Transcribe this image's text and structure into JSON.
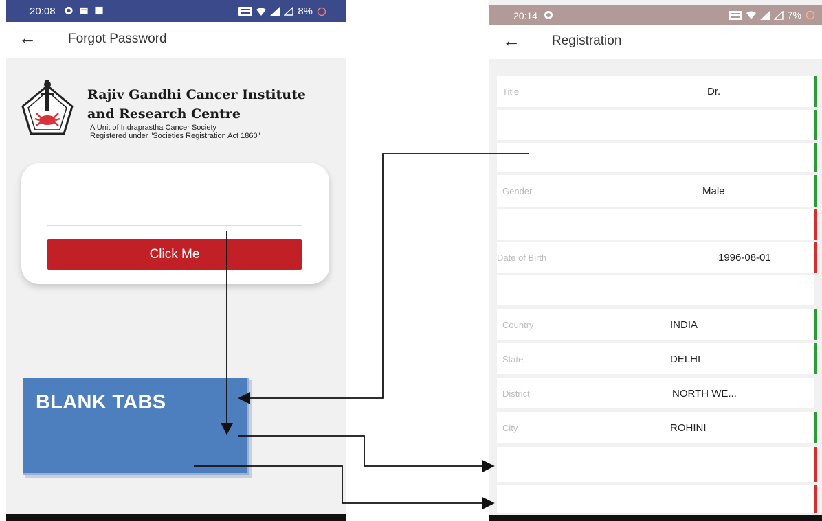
{
  "left_screen": {
    "status": {
      "time": "20:08",
      "battery": "8%"
    },
    "appbar": {
      "back_icon": "←",
      "title": "Forgot Password"
    },
    "institute": {
      "name_line1": "Rajiv Gandhi Cancer Institute",
      "name_line2": "and Research Centre",
      "sub_line1": "A Unit of Indraprastha Cancer Society",
      "sub_line2": "Registered under \"Societies Registration Act 1860\""
    },
    "button_label": "Click Me",
    "annotation_label": "BLANK TABS"
  },
  "right_screen": {
    "status": {
      "time": "20:14",
      "battery": "7%"
    },
    "appbar": {
      "back_icon": "←",
      "title": "Registration"
    },
    "rows": [
      {
        "label": "Title",
        "value": "Dr."
      },
      {
        "label": "",
        "value": ""
      },
      {
        "label": "",
        "value": ""
      },
      {
        "label": "Gender",
        "value": "Male"
      },
      {
        "label": "",
        "value": ""
      },
      {
        "label": "Date of Birth",
        "value": "1996-08-01"
      },
      {
        "label": "",
        "value": ""
      },
      {
        "label": "Country",
        "value": "INDIA"
      },
      {
        "label": "State",
        "value": "DELHI"
      },
      {
        "label": "District",
        "value": "NORTH WE..."
      },
      {
        "label": "City",
        "value": "ROHINI"
      },
      {
        "label": "",
        "value": ""
      },
      {
        "label": "",
        "value": ""
      }
    ]
  },
  "colors": {
    "status_left": "#3a4a8a",
    "status_right": "#b29a98",
    "button_red": "#c12126",
    "annotation_blue": "#4d7fbf",
    "valid_green": "#2e9b3a",
    "invalid_red": "#d32f2f"
  }
}
